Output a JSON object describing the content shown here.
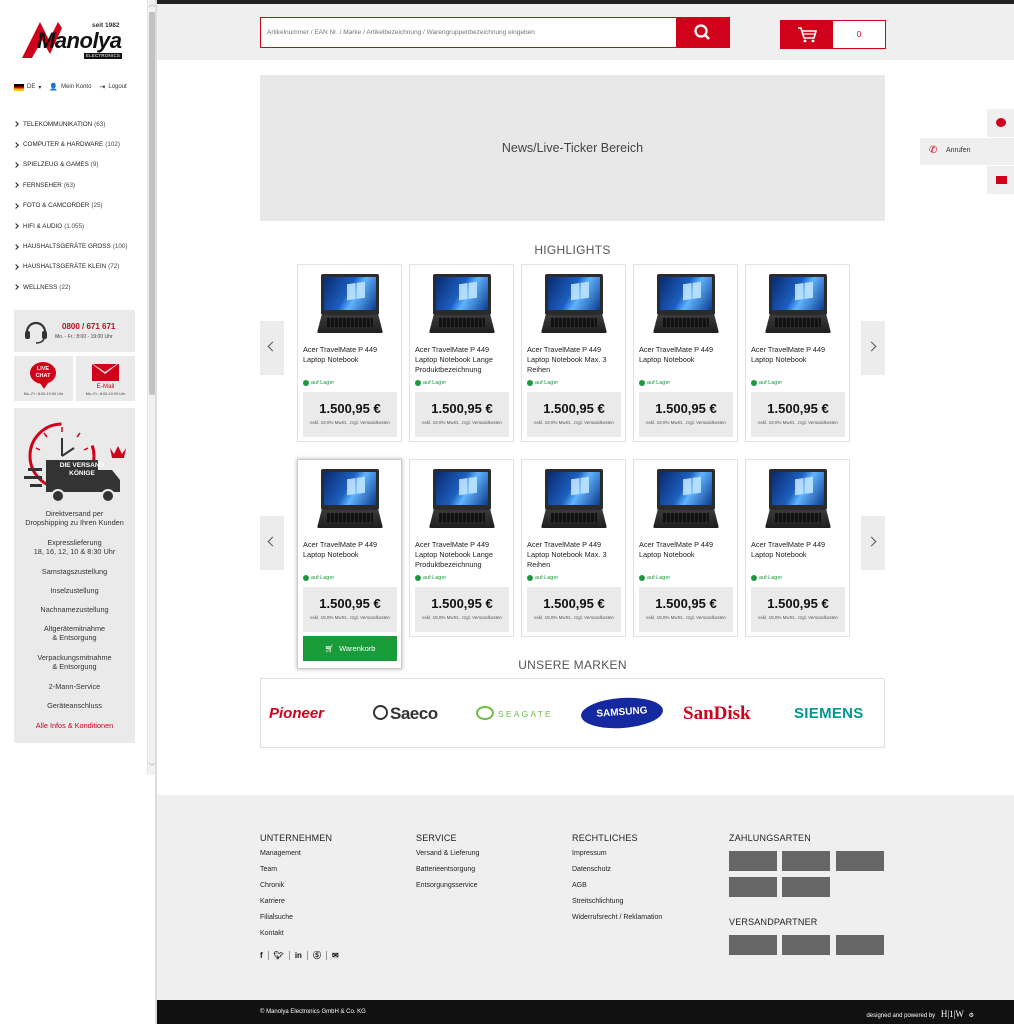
{
  "sidebar": {
    "logo_tagline": "seit 1982",
    "logo_text": "Manolya",
    "logo_sub": "ELECTRONICS",
    "language": "DE",
    "account_label": "Mein Konto",
    "logout_label": "Logout",
    "categories": [
      {
        "label": "TELEKOMMUNIKATION",
        "count": "(63)"
      },
      {
        "label": "COMPUTER & HARDWARE",
        "count": "(102)"
      },
      {
        "label": "SPIELZEUG & GAMES",
        "count": "(9)"
      },
      {
        "label": "FERNSEHER",
        "count": "(63)"
      },
      {
        "label": "FOTO & CAMCORDER",
        "count": "(25)"
      },
      {
        "label": "HIFI & AUDIO",
        "count": "(1.055)"
      },
      {
        "label": "HAUSHALTSGERÄTE GROSS",
        "count": "(100)"
      },
      {
        "label": "HAUSHALTSGERÄTE KLEIN",
        "count": "(72)"
      },
      {
        "label": "WELLNESS",
        "count": "(22)"
      }
    ],
    "hotline_number": "0800 / 671 671",
    "hotline_hours": "Mo. - Fr.: 8:00 - 19:00 Uhr",
    "livechat_label": "LIVE CHAT",
    "livechat_hours": "Mo.-Fr.: 8:00-19:00 Uhr",
    "email_label": "E-Mail",
    "email_hours": "Mo.-Fr.: 8:00-19:00 Uhr",
    "versand_badge": "DIE VERSAND KÖNIGE",
    "versand_lines": [
      "Direktversand per",
      "Dropshipping zu Ihren Kunden",
      "Expresslieferung",
      "18, 16, 12, 10 & 8:30 Uhr",
      "Samstagszustellung",
      "Inselzustellung",
      "Nachnamezustellung",
      "Altgerätemitnahme",
      "& Entsorgung",
      "Verpackungsmitnahme",
      "& Entsorgung",
      "2-Mann-Service",
      "Geräteanschluss"
    ],
    "versand_link": "Alle Infos & Konditionen"
  },
  "header": {
    "search_placeholder": "Artikelnummer / EAN Nr. / Marke / Artikelbezeichnung / Warengruppenbezeichnung eingeben",
    "cart_count": "0"
  },
  "ticker_text": "News/Live-Ticker Bereich",
  "highlights_title": "HIGHLIGHTS",
  "products_row1": [
    {
      "title": "Acer TravelMate P 449 Laptop Notebook",
      "stock": "auf Lager",
      "price": "1.500,95 €",
      "vat": "exkl. 19,0% MwSt., zzgl. Versandkosten"
    },
    {
      "title": "Acer TravelMate P 449 Laptop Notebook Lange Produktbezeichnung",
      "stock": "auf Lager",
      "price": "1.500,95 €",
      "vat": "exkl. 19,0% MwSt., zzgl. Versandkosten"
    },
    {
      "title": "Acer TravelMate P 449 Laptop Notebook Max. 3 Reihen",
      "stock": "auf Lager",
      "price": "1.500,95 €",
      "vat": "exkl. 19,0% MwSt., zzgl. Versandkosten"
    },
    {
      "title": "Acer TravelMate P 449 Laptop Notebook",
      "stock": "auf Lager",
      "price": "1.500,95 €",
      "vat": "exkl. 19,0% MwSt., zzgl. Versandkosten"
    },
    {
      "title": "Acer TravelMate P 449 Laptop Notebook",
      "stock": "auf Lager",
      "price": "1.500,95 €",
      "vat": "exkl. 19,0% MwSt., zzgl. Versandkosten"
    }
  ],
  "products_row2": [
    {
      "title": "Acer TravelMate P 449 Laptop Notebook",
      "stock": "auf Lager",
      "price": "1.500,95 €",
      "vat": "exkl. 19,0% MwSt., zzgl. Versandkosten"
    },
    {
      "title": "Acer TravelMate P 449 Laptop Notebook Lange Produktbezeichnung",
      "stock": "auf Lager",
      "price": "1.500,95 €",
      "vat": "exkl. 19,0% MwSt., zzgl. Versandkosten"
    },
    {
      "title": "Acer TravelMate P 449 Laptop Notebook Max. 3 Reihen",
      "stock": "auf Lager",
      "price": "1.500,95 €",
      "vat": "exkl. 19,0% MwSt., zzgl. Versandkosten"
    },
    {
      "title": "Acer TravelMate P 449 Laptop Notebook",
      "stock": "auf Lager",
      "price": "1.500,95 €",
      "vat": "exkl. 19,0% MwSt., zzgl. Versandkosten"
    },
    {
      "title": "Acer TravelMate P 449 Laptop Notebook",
      "stock": "auf Lager",
      "price": "1.500,95 €",
      "vat": "exkl. 19,0% MwSt., zzgl. Versandkosten"
    }
  ],
  "add_to_cart_label": "Warenkorb",
  "brands_title": "UNSERE MARKEN",
  "brands": [
    {
      "name": "Pioneer",
      "color": "#d0021b"
    },
    {
      "name": "Saeco",
      "color": "#333333"
    },
    {
      "name": "SEAGATE",
      "color": "#6cbe45"
    },
    {
      "name": "SAMSUNG",
      "color": "#1428a0"
    },
    {
      "name": "SanDisk",
      "color": "#d0021b"
    },
    {
      "name": "SIEMENS",
      "color": "#00988f"
    }
  ],
  "floating": {
    "call_label": "Anrufen"
  },
  "footer": {
    "col1_title": "UNTERNEHMEN",
    "col1_links": [
      "Management",
      "Team",
      "Chronik",
      "Karriere",
      "Filialsuche",
      "Kontakt"
    ],
    "col2_title": "SERVICE",
    "col2_links": [
      "Versand & Lieferung",
      "Batterieentsorgung",
      "Entsorgungsservice"
    ],
    "col3_title": "RECHTLICHES",
    "col3_links": [
      "Impressum",
      "Datenschutz",
      "AGB",
      "Streitschlichtung",
      "Widerrufsrecht / Reklamation"
    ],
    "col4_title": "ZAHLUNGSARTEN",
    "col4b_title": "VERSANDPARTNER",
    "social": [
      "f",
      "twitter",
      "in",
      "skype",
      "mail"
    ],
    "copyright": "© Manolya Electronics GmbH & Co. KG",
    "powered_by": "designed and powered by",
    "powered_logo": "H|1|W"
  },
  "colors": {
    "accent": "#d0021b",
    "stock_green": "#1a9b3a",
    "footer_bg": "#efefef"
  }
}
